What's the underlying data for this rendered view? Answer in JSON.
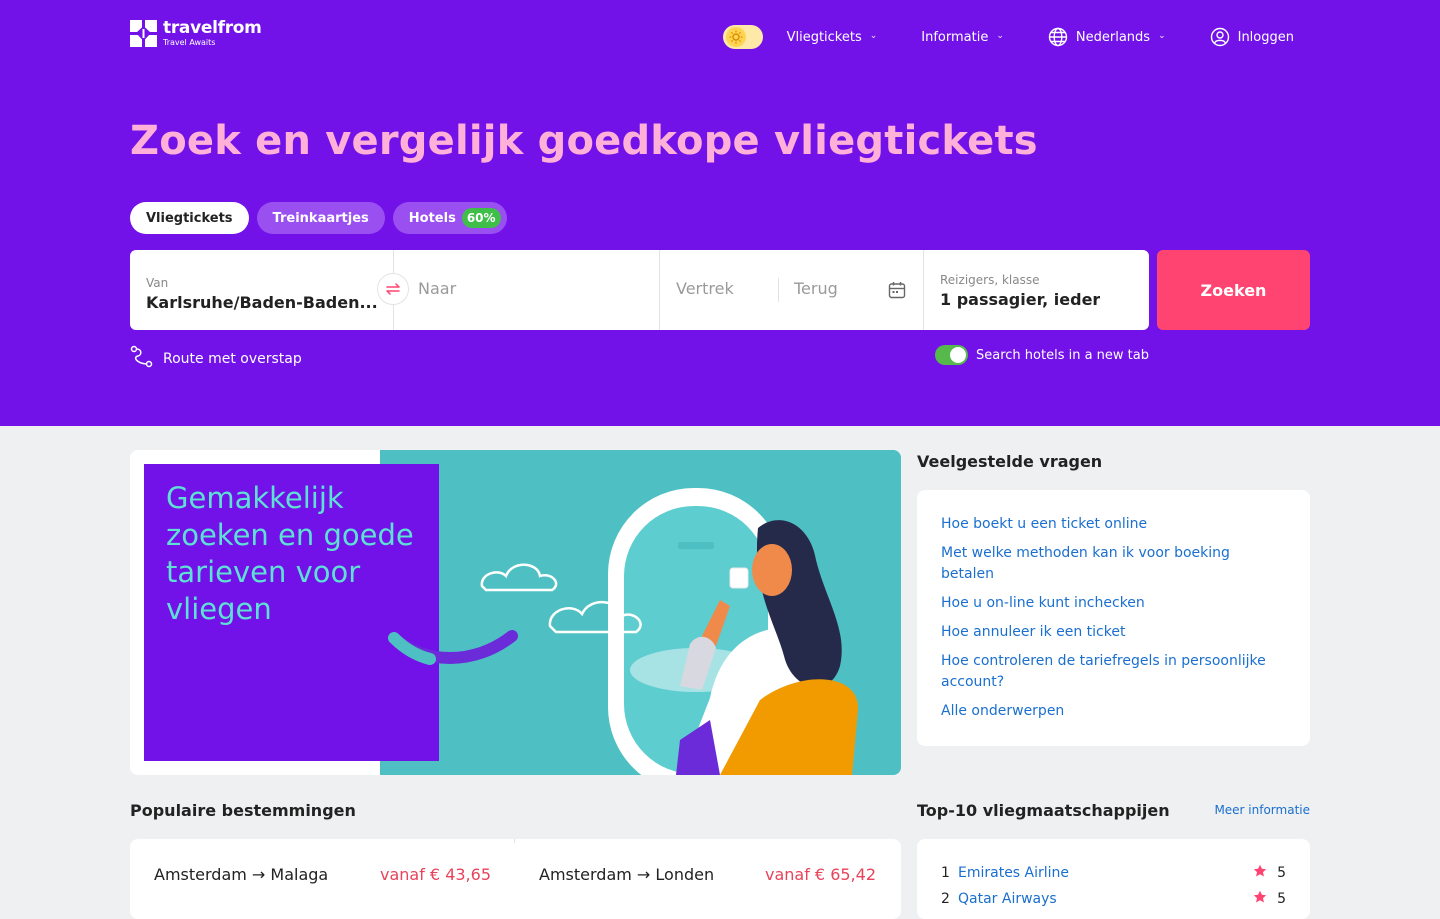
{
  "header": {
    "logo_name": "travelfrom",
    "logo_tagline": "Travel Awaits",
    "nav": [
      {
        "label": "Vliegtickets"
      },
      {
        "label": "Informatie"
      },
      {
        "label": "Nederlands"
      },
      {
        "label": "Inloggen"
      }
    ]
  },
  "hero": {
    "headline": "Zoek en vergelijk goedkope vliegtickets",
    "tabs": [
      {
        "label": "Vliegtickets"
      },
      {
        "label": "Treinkaartjes"
      },
      {
        "label": "Hotels",
        "badge": "60%"
      }
    ]
  },
  "search": {
    "from_label": "Van",
    "from_value": "Karlsruhe/Baden-Baden...",
    "to_placeholder": "Naar",
    "depart_placeholder": "Vertrek",
    "return_placeholder": "Terug",
    "pax_label": "Reizigers, klasse",
    "pax_value": "1 passagier, ieder",
    "submit_label": "Zoeken",
    "route_label": "Route met overstap",
    "hotels_toggle_label": "Search hotels in a new tab",
    "hotels_toggle_on": true
  },
  "banner": {
    "text": "Gemakkelijk zoeken en goede tarieven voor vliegen"
  },
  "faq": {
    "title": "Veelgestelde vragen",
    "links": [
      "Hoe boekt u een ticket online",
      "Met welke methoden kan ik voor boeking betalen",
      "Hoe u on-line kunt inchecken",
      "Hoe annuleer ik een ticket",
      "Hoe controleren de tariefregels in persoonlijke account?",
      "Alle onderwerpen"
    ]
  },
  "popular": {
    "title": "Populaire bestemmingen",
    "items": [
      {
        "route": "Amsterdam → Malaga",
        "price": "vanaf € 43,65"
      },
      {
        "route": "Amsterdam → Londen",
        "price": "vanaf € 65,42"
      }
    ]
  },
  "airlines": {
    "title": "Top-10 vliegmaatschappijen",
    "more_label": "Meer informatie",
    "items": [
      {
        "rank": "1",
        "name": "Emirates Airline",
        "rating": "5"
      },
      {
        "rank": "2",
        "name": "Qatar Airways",
        "rating": "5"
      }
    ]
  },
  "colors": {
    "hero_bg": "#7212e8",
    "headline": "#ffb0d8",
    "search_button": "#ff4471",
    "link": "#1a6fcf",
    "price": "#e8435a",
    "toggle_on": "#55b94b"
  }
}
